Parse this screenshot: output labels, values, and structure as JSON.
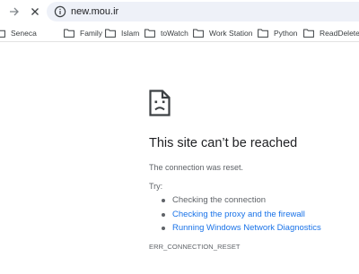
{
  "address_bar": {
    "url": "new.mou.ir"
  },
  "bookmarks": [
    {
      "label": "Seneca"
    },
    {
      "label": "Family"
    },
    {
      "label": "Islam"
    },
    {
      "label": "toWatch"
    },
    {
      "label": "Work Station"
    },
    {
      "label": "Python"
    },
    {
      "label": "ReadDelete"
    }
  ],
  "error": {
    "title": "This site can’t be reached",
    "message": "The connection was reset.",
    "try_label": "Try:",
    "suggestions": [
      {
        "text": "Checking the connection",
        "type": "text"
      },
      {
        "text": "Checking the proxy and the firewall",
        "type": "link"
      },
      {
        "text": "Running Windows Network Diagnostics",
        "type": "link"
      }
    ],
    "code": "ERR_CONNECTION_RESET"
  },
  "colors": {
    "link": "#1a73e8",
    "omnibox_bg": "#eef1f8",
    "text_secondary": "#5f6368"
  }
}
